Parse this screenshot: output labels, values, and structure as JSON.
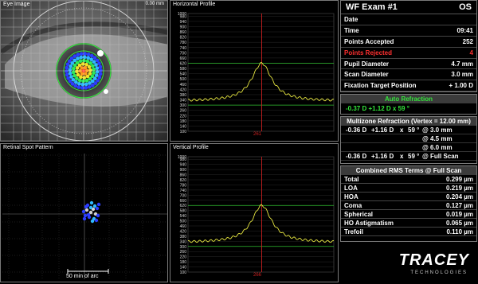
{
  "eye_image": {
    "title": "Eye Image",
    "scale_readout": "0.00 mm"
  },
  "spot_pattern": {
    "title": "Retinal Spot Pattern",
    "scale_bar_label": "50 min of arc"
  },
  "horizontal_profile": {
    "title": "Horizontal Profile",
    "y_ticks": [
      "1000",
      "980",
      "940",
      "900",
      "860",
      "820",
      "780",
      "740",
      "700",
      "660",
      "620",
      "580",
      "540",
      "500",
      "460",
      "420",
      "380",
      "340",
      "300",
      "260",
      "220",
      "180",
      "140",
      "100"
    ],
    "marker_label": "261"
  },
  "vertical_profile": {
    "title": "Vertical Profile",
    "y_ticks": [
      "1000",
      "980",
      "940",
      "900",
      "860",
      "820",
      "780",
      "740",
      "700",
      "660",
      "620",
      "580",
      "540",
      "500",
      "460",
      "420",
      "380",
      "340",
      "300",
      "260",
      "220",
      "180",
      "140",
      "100"
    ],
    "marker_label": "266"
  },
  "exam": {
    "title": "WF Exam  #1",
    "eye": "OS",
    "rows": [
      {
        "label": "Date",
        "value": "",
        "highlight": false
      },
      {
        "label": "Time",
        "value": "09:41",
        "highlight": false
      },
      {
        "label": "Points Accepted",
        "value": "252",
        "highlight": false
      },
      {
        "label": "Points Rejected",
        "value": "4",
        "highlight": true
      },
      {
        "label": "Pupil Diameter",
        "value": "4.7 mm",
        "highlight": false
      },
      {
        "label": "Scan Diameter",
        "value": "3.0 mm",
        "highlight": false
      },
      {
        "label": "Fixation Target Position",
        "value": "+ 1.00 D",
        "highlight": false
      }
    ]
  },
  "auto_refraction": {
    "title": "Auto Refraction",
    "value": "-0.37 D    +1.12 D   x   59 °"
  },
  "multizone": {
    "title": "Multizone Refraction  (Vertex = 12.00 mm)",
    "rows": [
      {
        "sph": "-0.36 D",
        "cyl": "+1.16 D",
        "x": "x",
        "axis": "59 °",
        "at": "@",
        "zone": "3.0 mm"
      },
      {
        "sph": "",
        "cyl": "",
        "x": "",
        "axis": "",
        "at": "@",
        "zone": "4.5 mm"
      },
      {
        "sph": "",
        "cyl": "",
        "x": "",
        "axis": "",
        "at": "@",
        "zone": "6.0 mm"
      },
      {
        "sph": "-0.36 D",
        "cyl": "+1.16 D",
        "x": "x",
        "axis": "59 °",
        "at": "@",
        "zone": "Full Scan"
      }
    ]
  },
  "rms": {
    "title": "Combined RMS Terms @ Full Scan",
    "rows": [
      {
        "label": "Total",
        "value": "0.299 µm"
      },
      {
        "label": "LOA",
        "value": "0.219 µm"
      },
      {
        "label": "HOA",
        "value": "0.204 µm"
      },
      {
        "label": "Coma",
        "value": "0.127 µm"
      },
      {
        "label": "Spherical",
        "value": "0.019 µm"
      },
      {
        "label": "HO Astigmatism",
        "value": "0.065 µm"
      },
      {
        "label": "Trefoil",
        "value": "0.110 µm"
      }
    ]
  },
  "brand": {
    "name": "TRACEY",
    "sub": "TECHNOLOGIES"
  },
  "colors": {
    "profile_curve": "#e6e640",
    "marker": "#cc2020",
    "guide": "#30c030",
    "accent_green": "#34e63c",
    "alert_red": "#ff3030"
  }
}
